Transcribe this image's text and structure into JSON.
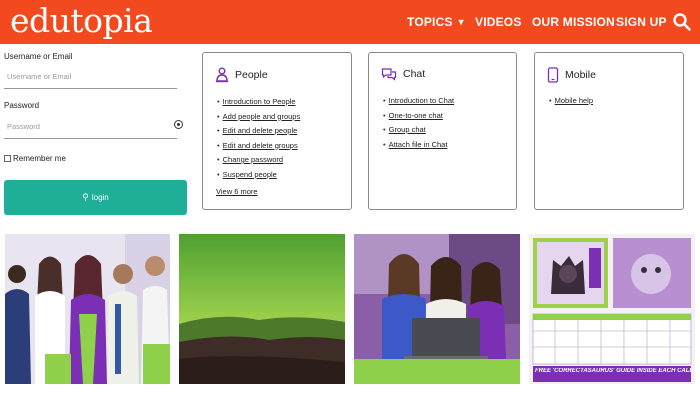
{
  "header": {
    "logo": "edutopia",
    "nav": [
      "TOPICS",
      "VIDEOS",
      "OUR MISSION",
      "SIGN UP"
    ],
    "topics_chevron": "chevron-down-icon",
    "search_icon": "search-icon",
    "color": "#f24a1e"
  },
  "login": {
    "username_label": "Username or Email",
    "username_placeholder": "Username or Email",
    "password_label": "Password",
    "password_placeholder": "Password",
    "show_password_icon": "eye-icon",
    "remember_label": "Remember me",
    "button_label": "login",
    "button_color": "#1fae97"
  },
  "cards": [
    {
      "title": "People",
      "icon": "people-icon",
      "links": [
        "Introduction to People",
        "Add people and groups",
        "Edit and delete people",
        "Edit and delete groups",
        "Change password",
        "Suspend people"
      ],
      "more": "View 6 more"
    },
    {
      "title": "Chat",
      "icon": "chat-icon",
      "links": [
        "Introduction to Chat",
        "One-to-one chat",
        "Group chat",
        "Attach file in Chat"
      ]
    },
    {
      "title": "Mobile",
      "icon": "mobile-icon",
      "links": [
        "Mobile help"
      ]
    }
  ],
  "tiles": [
    {
      "name": "students-group-photo"
    },
    {
      "name": "landscape-photo"
    },
    {
      "name": "students-laptop-photo"
    },
    {
      "name": "calendar-promo-photo",
      "caption": "FREE 'CORRECTASAURUS' GUIDE INSIDE EACH CALENDAR!"
    }
  ]
}
